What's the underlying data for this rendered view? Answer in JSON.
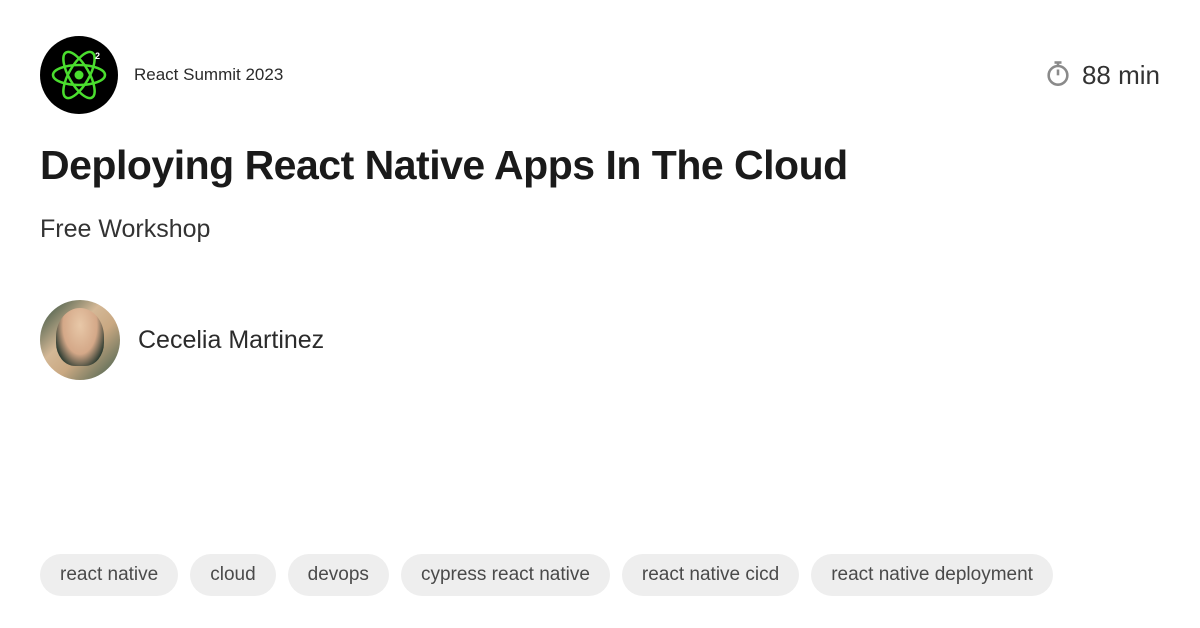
{
  "event": {
    "name": "React Summit 2023"
  },
  "duration": {
    "text": "88 min"
  },
  "title": "Deploying React Native Apps In The Cloud",
  "subtitle": "Free Workshop",
  "speaker": {
    "name": "Cecelia Martinez"
  },
  "tags": [
    "react native",
    "cloud",
    "devops",
    "cypress react native",
    "react native cicd",
    "react native deployment"
  ]
}
